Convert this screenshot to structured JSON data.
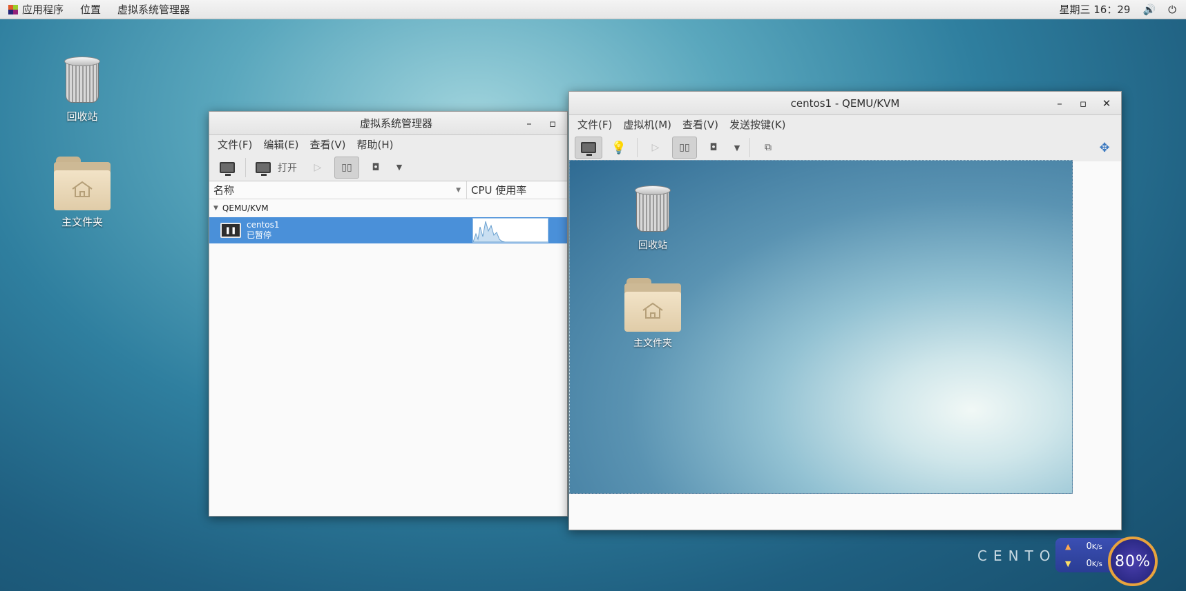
{
  "topbar": {
    "applications": "应用程序",
    "places": "位置",
    "active_app": "虚拟系统管理器",
    "clock": "星期三 16：29"
  },
  "desktop": {
    "trash_label": "回收站",
    "home_label": "主文件夹"
  },
  "vmm_window": {
    "title": "虚拟系统管理器",
    "menu": [
      "文件(F)",
      "编辑(E)",
      "查看(V)",
      "帮助(H)"
    ],
    "toolbar_open": "打开",
    "col_name": "名称",
    "col_cpu": "CPU 使用率",
    "group": "QEMU/KVM",
    "vm": {
      "name": "centos1",
      "status": "已暂停"
    }
  },
  "console_window": {
    "title": "centos1 - QEMU/KVM",
    "menu": [
      "文件(F)",
      "虚拟机(M)",
      "查看(V)",
      "发送按键(K)"
    ],
    "guest_trash_label": "回收站",
    "guest_home_label": "主文件夹"
  },
  "branding": {
    "centos_text": "CENTOS"
  },
  "net_widget": {
    "up_value": "0",
    "up_unit": "K/s",
    "down_value": "0",
    "down_unit": "K/s",
    "gauge_percent": "80%"
  },
  "colors": {
    "selection": "#4a90d9",
    "gauge_ring": "#e8a33d",
    "widget_bg": "#2a3d94"
  }
}
